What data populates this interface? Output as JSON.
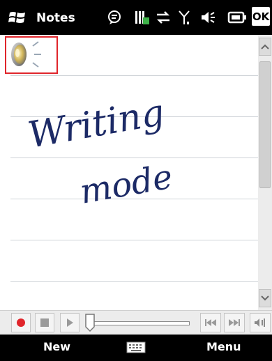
{
  "title_bar": {
    "app_name": "Notes",
    "ok_label": "OK"
  },
  "note": {
    "handwriting_line1": "Writing",
    "handwriting_line2": "mode"
  },
  "soft_keys": {
    "left": "New",
    "right": "Menu"
  },
  "colors": {
    "record_red": "#e0252b",
    "ink": "#1c2a66",
    "selection_border": "#e0252b"
  },
  "icons": [
    "windows-start-icon",
    "messaging-icon",
    "signal-battery-icon",
    "connectivity-icon",
    "antenna-icon",
    "speaker-volume-icon",
    "battery-icon",
    "speaker-voice-note-icon",
    "record-icon",
    "stop-icon",
    "play-icon",
    "skip-back-icon",
    "skip-forward-icon",
    "volume-icon",
    "keyboard-icon"
  ]
}
